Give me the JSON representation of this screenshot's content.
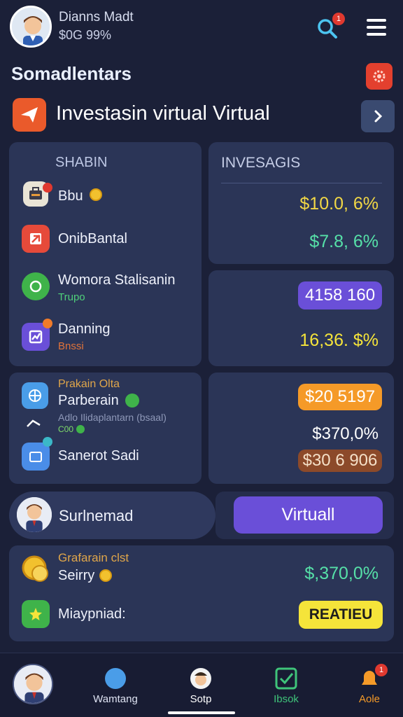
{
  "header": {
    "user_name": "Dianns Madt",
    "user_stat": "$0G 99%",
    "search_badge": "1"
  },
  "section": {
    "title": "Somadlentars",
    "banner_title": "Investasin virtual Virtual"
  },
  "shares_card": {
    "heading": "SHABIN",
    "items": [
      {
        "label": "Bbu",
        "sub": ""
      },
      {
        "label": "OnibBantal",
        "sub": ""
      },
      {
        "label": "Womora Stalisanin",
        "sub": "Trupo"
      },
      {
        "label": "Danning",
        "sub": "Bnssi"
      }
    ]
  },
  "invest_card": {
    "heading": "INVESAGIS",
    "value_1": "$10.0, 6%",
    "value_2": "$7.8, 6%",
    "pill_1": "4158 160",
    "value_3": "16,36. $%"
  },
  "partner_card": {
    "top_label": "Prakain Olta",
    "partner_label": "Parberain",
    "sub_line": "Adlo Ilidaplantarn (bsaal)",
    "small_label": "C00",
    "item_label": "Sanerot Sadi"
  },
  "partner_values": {
    "pill_orange": "$20 5197",
    "value": "$370,0%",
    "pill_brown": "$30 6 906"
  },
  "profile_row": {
    "name": "Surlnemad",
    "button": "Virtuall"
  },
  "bottom_card": {
    "label_top": "Grafarain clst",
    "label_1": "Seirry",
    "label_2": "Miaypniad:",
    "value": "$,370,0%",
    "button": "REATIEU"
  },
  "bottom_nav": {
    "items": [
      {
        "label": ""
      },
      {
        "label": "Wamtang"
      },
      {
        "label": "Sotp"
      },
      {
        "label": "Ibsok"
      },
      {
        "label": "Aole"
      }
    ],
    "badge": "1"
  },
  "colors": {
    "background": "#1b2038",
    "card": "#2b3557",
    "purple": "#6a4fd8",
    "yellow": "#f5e43a",
    "orange": "#f59a28",
    "green_text": "#56e0a8"
  }
}
